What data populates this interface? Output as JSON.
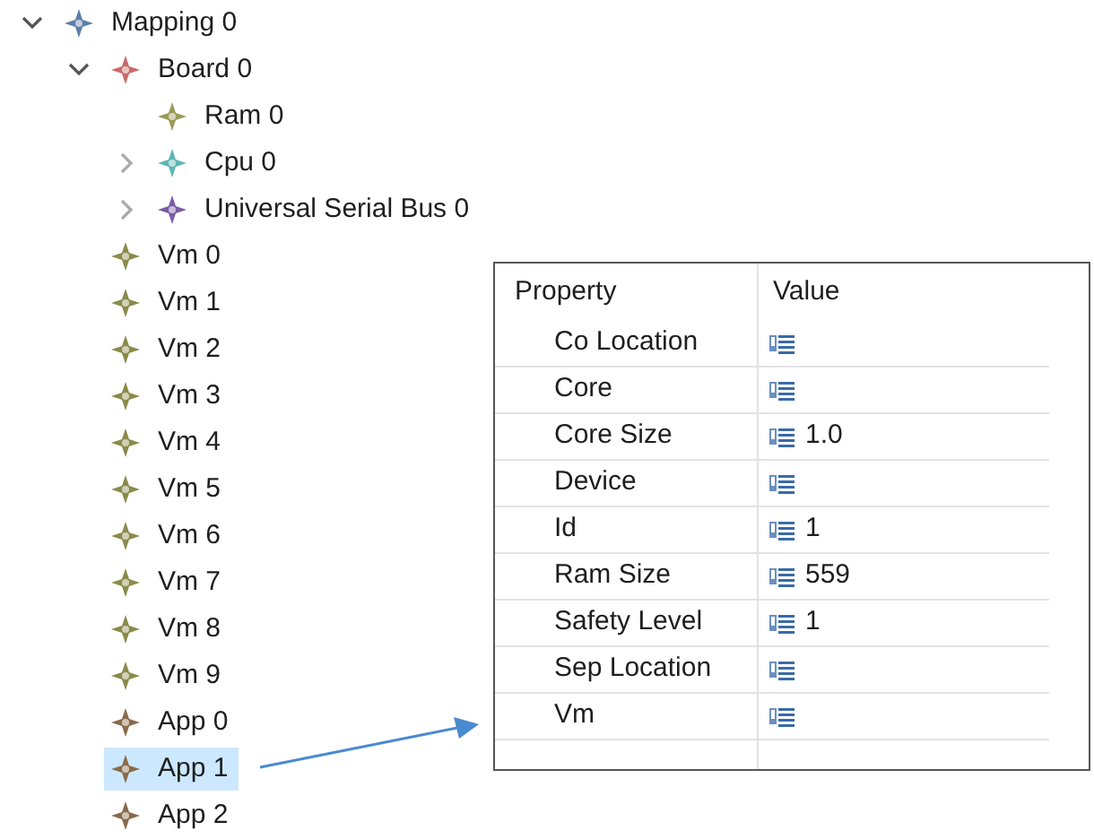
{
  "tree": [
    {
      "label": "Mapping 0",
      "color": "#5b7fa6",
      "expanded": true,
      "selected": false,
      "children": [
        {
          "label": "Board 0",
          "color": "#c96a6a",
          "expanded": true,
          "selected": false,
          "children": [
            {
              "label": "Ram 0",
              "color": "#9a9a58",
              "selected": false
            },
            {
              "label": "Cpu 0",
              "color": "#5fb5b5",
              "expanded": false,
              "selected": false
            },
            {
              "label": "Universal Serial Bus 0",
              "color": "#7a5aa6",
              "expanded": false,
              "selected": false
            }
          ]
        },
        {
          "label": "Vm 0",
          "color": "#8a8a4a",
          "selected": false
        },
        {
          "label": "Vm 1",
          "color": "#8a8a4a",
          "selected": false
        },
        {
          "label": "Vm 2",
          "color": "#8a8a4a",
          "selected": false
        },
        {
          "label": "Vm 3",
          "color": "#8a8a4a",
          "selected": false
        },
        {
          "label": "Vm 4",
          "color": "#8a8a4a",
          "selected": false
        },
        {
          "label": "Vm 5",
          "color": "#8a8a4a",
          "selected": false
        },
        {
          "label": "Vm 6",
          "color": "#8a8a4a",
          "selected": false
        },
        {
          "label": "Vm 7",
          "color": "#8a8a4a",
          "selected": false
        },
        {
          "label": "Vm 8",
          "color": "#8a8a4a",
          "selected": false
        },
        {
          "label": "Vm 9",
          "color": "#8a8a4a",
          "selected": false
        },
        {
          "label": "App 0",
          "color": "#8a6a4a",
          "selected": false
        },
        {
          "label": "App 1",
          "color": "#8a6a4a",
          "selected": true
        },
        {
          "label": "App 2",
          "color": "#8a6a4a",
          "selected": false
        }
      ]
    }
  ],
  "properties": {
    "columns": [
      "Property",
      "Value"
    ],
    "rows": [
      {
        "name": "Co Location"
      },
      {
        "name": "Core"
      },
      {
        "name": "Core Size",
        "value": "1.0"
      },
      {
        "name": "Device"
      },
      {
        "name": "Id",
        "value": "1"
      },
      {
        "name": "Ram Size",
        "value": "559"
      },
      {
        "name": "Safety Level",
        "value": "1"
      },
      {
        "name": "Sep Location"
      },
      {
        "name": "Vm"
      }
    ]
  }
}
